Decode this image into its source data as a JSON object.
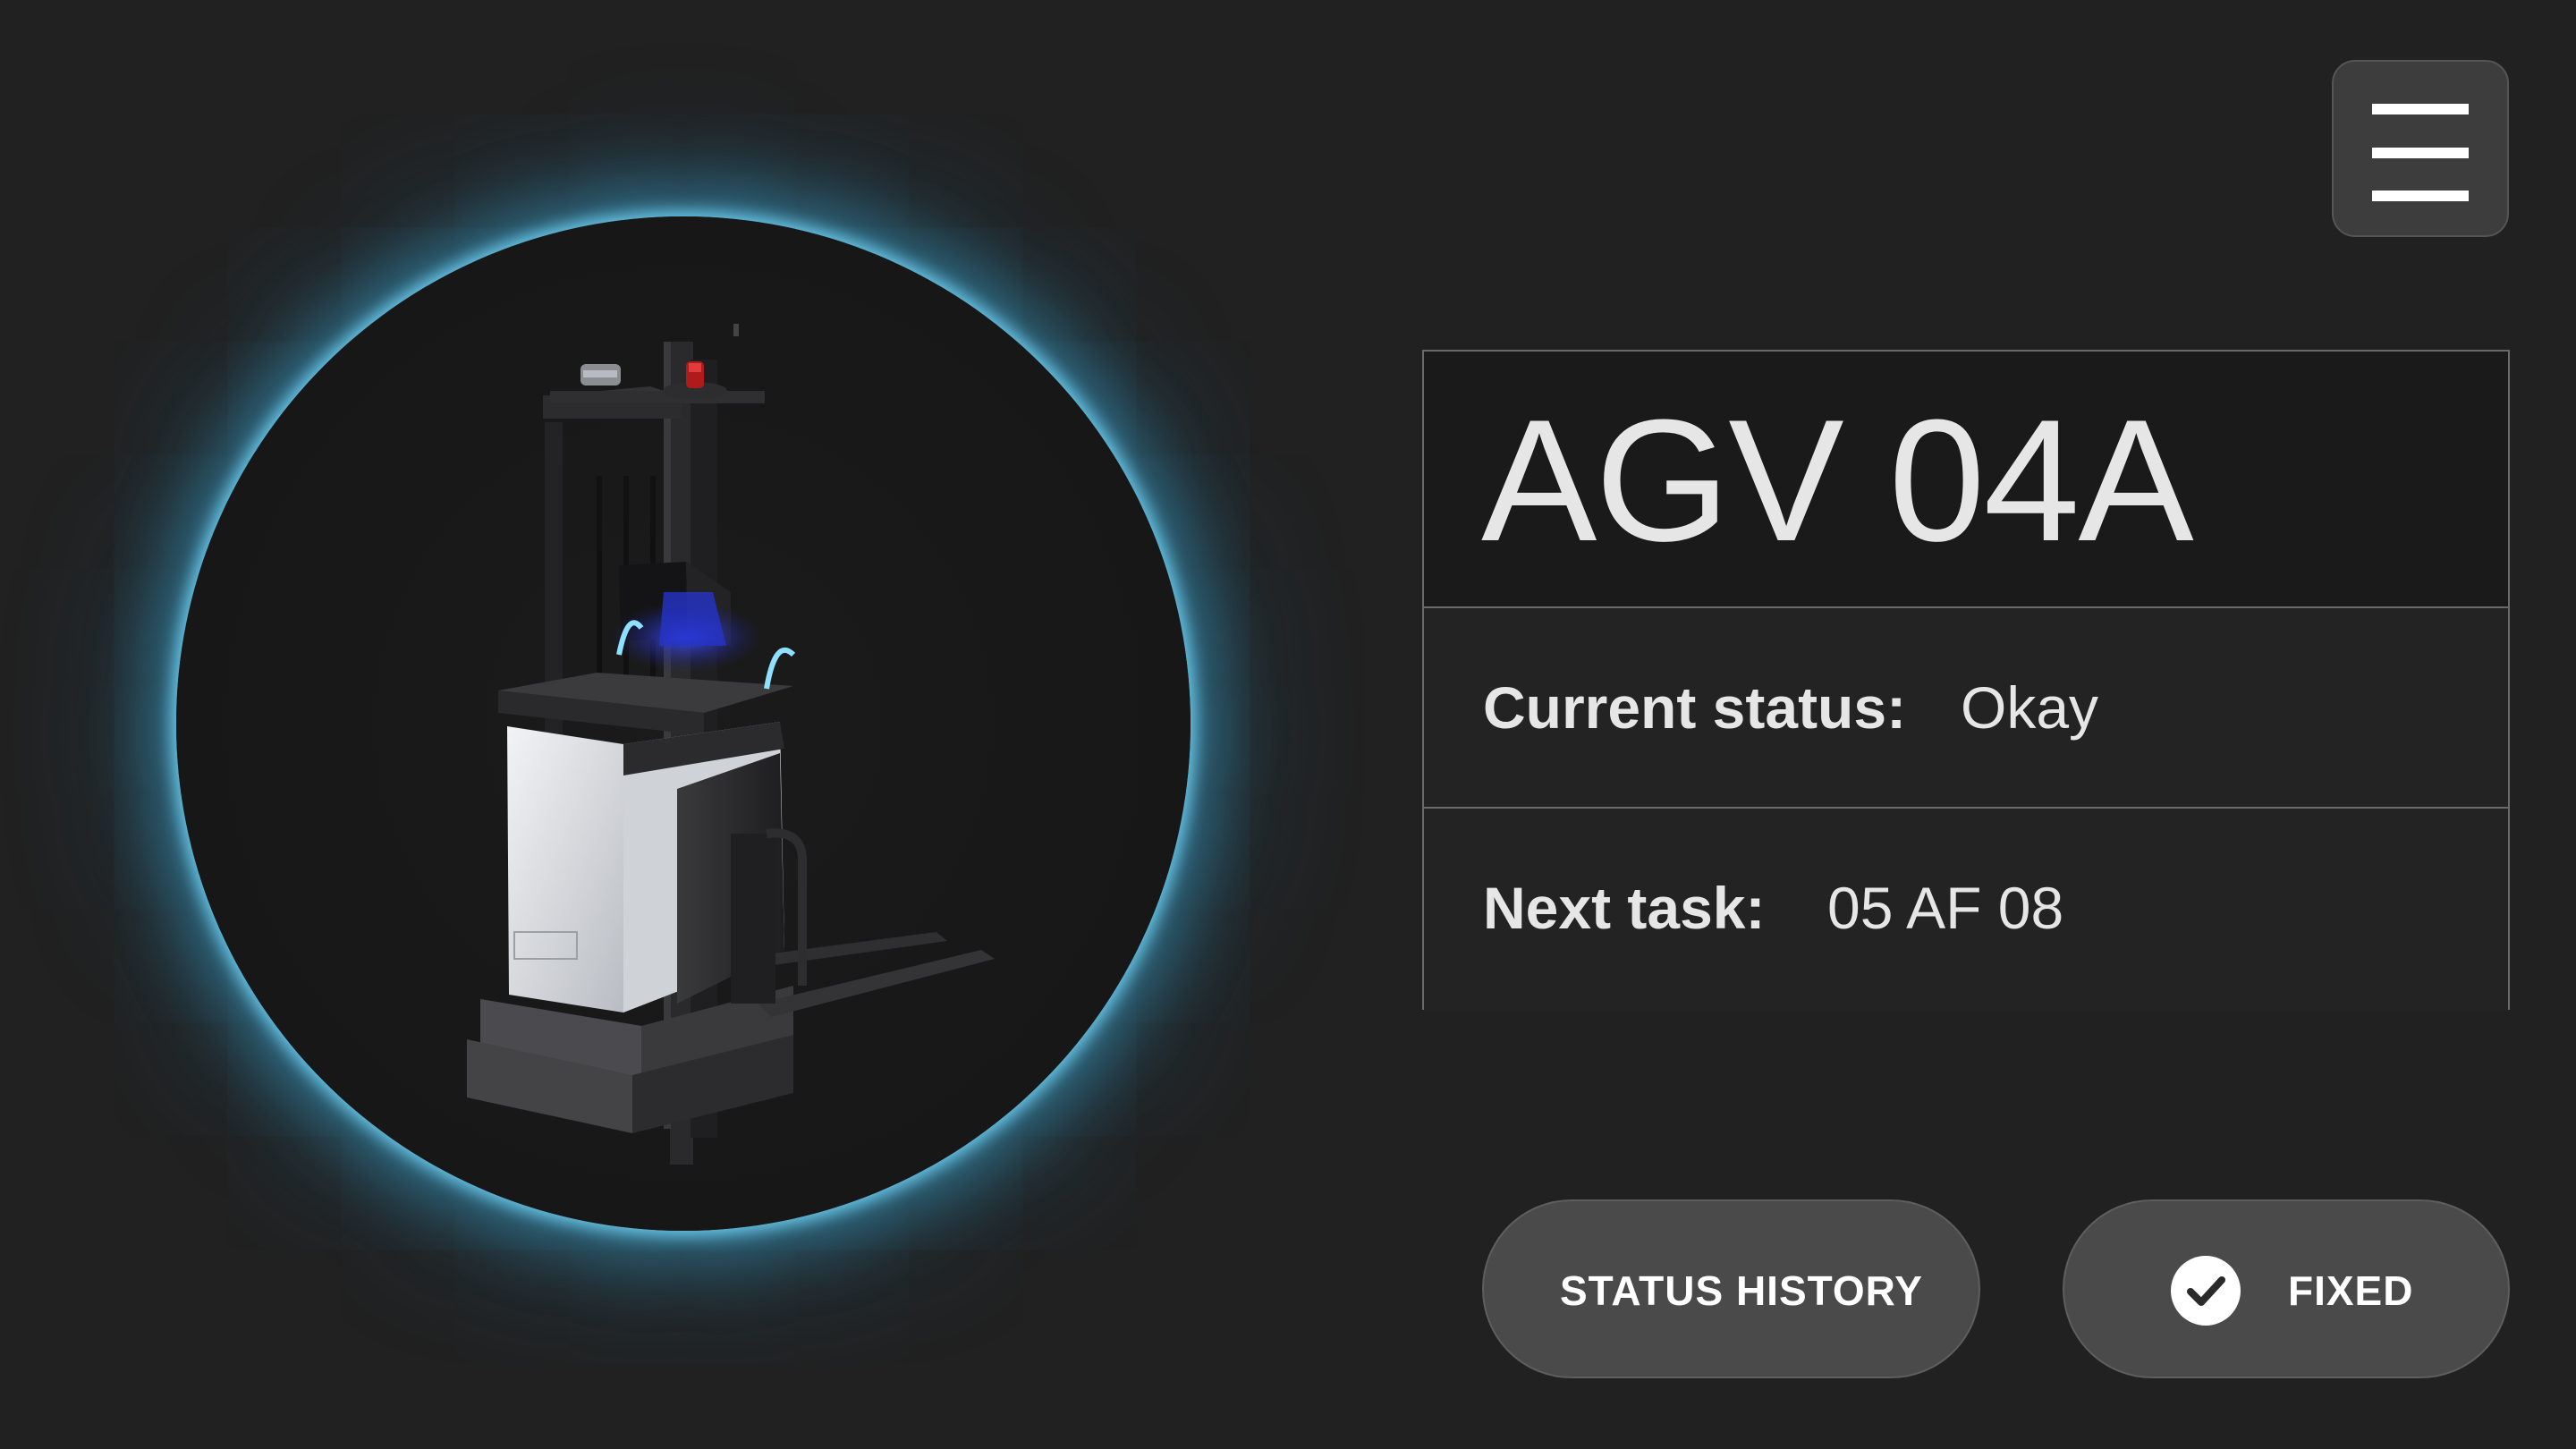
{
  "vehicle": {
    "name": "AGV 04A",
    "status_label": "Current status:",
    "status_value": "Okay",
    "task_label": "Next task:",
    "task_value": "05 AF 08"
  },
  "actions": {
    "history_label": "STATUS HISTORY",
    "fixed_label": "FIXED"
  },
  "icons": {
    "menu": "hamburger-menu-icon",
    "fixed": "check-circle-icon"
  },
  "colors": {
    "background": "#212121",
    "glow": "#5ec8e6",
    "button": "#4a4a4a",
    "text": "#e6e6e6"
  }
}
